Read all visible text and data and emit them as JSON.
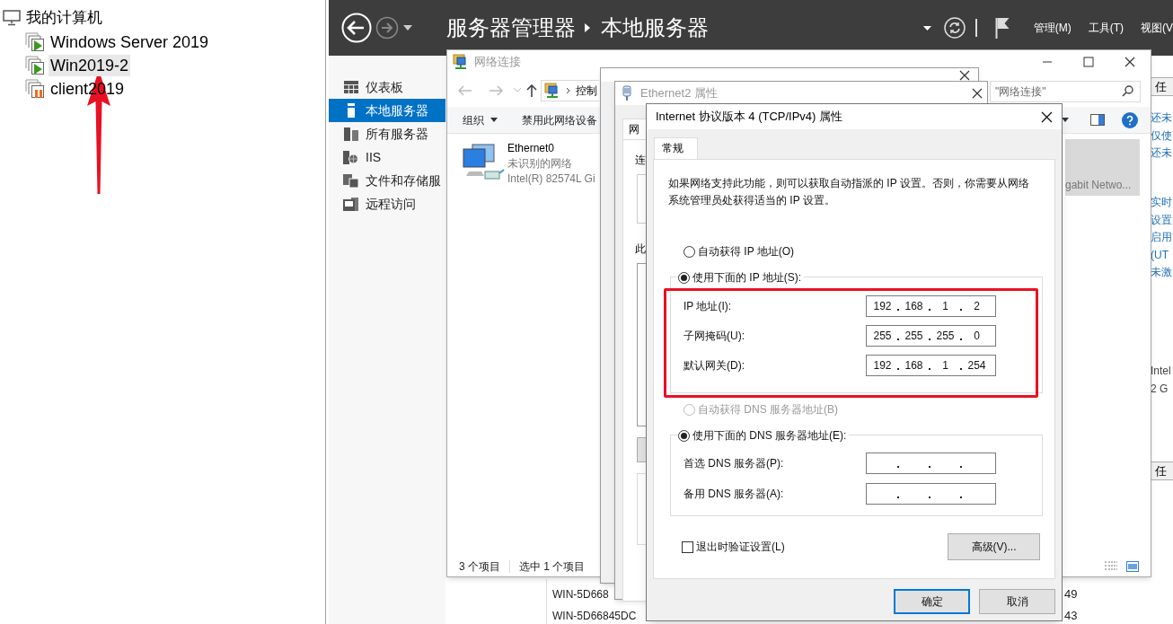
{
  "vm_tree": {
    "label": "我的计算机",
    "children": [
      {
        "label": "Windows Server 2019",
        "kind": "running",
        "selected": false
      },
      {
        "label": "Win2019-2",
        "kind": "running",
        "selected": true
      },
      {
        "label": "client2019",
        "kind": "paused",
        "selected": false
      }
    ]
  },
  "server_manager": {
    "breadcrumb": [
      "服务器管理器",
      "本地服务器"
    ],
    "menus": [
      "管理(M)",
      "工具(T)",
      "视图(V"
    ],
    "nav": [
      {
        "label": "仪表板",
        "kind": "dashboard",
        "selected": false
      },
      {
        "label": "本地服务器",
        "kind": "server",
        "selected": true
      },
      {
        "label": "所有服务器",
        "kind": "servers",
        "selected": false
      },
      {
        "label": "IIS",
        "kind": "iis",
        "selected": false
      },
      {
        "label": "文件和存储服",
        "kind": "files",
        "selected": false
      },
      {
        "label": "远程访问",
        "kind": "remote",
        "selected": false
      }
    ],
    "side_panel": {
      "top_button": "任",
      "links_1": [
        "还未",
        "仅使",
        "还未"
      ],
      "links_2": [
        "实时",
        "设置",
        "启用",
        "(UT",
        "未激"
      ],
      "details": [
        "Intel",
        "2 G"
      ],
      "bottom_button": "任"
    },
    "server_list": [
      {
        "name": "WIN-5D668",
        "column_2": "49"
      },
      {
        "name": "WIN-5D66845DC",
        "column_2": "43"
      }
    ]
  },
  "network_window": {
    "title": "网络连接",
    "address": "控制",
    "search_placeholder": "\"网络连接\"",
    "toolbar": [
      "组织",
      "禁用此网络设备"
    ],
    "items": [
      {
        "name": "Ethernet0",
        "status": "未识别的网络",
        "device": "Intel(R) 82574L Gi",
        "selected": false
      },
      {
        "device": "gabit Netwo...",
        "selected": true
      }
    ],
    "status_bar": [
      "3 个项目",
      "选中 1 个项目"
    ]
  },
  "properties_window": {
    "title": "Ethernet2 属性",
    "tab": "网",
    "labels": [
      "连",
      "此"
    ]
  },
  "ipv4_dialog": {
    "title": "Internet 协议版本 4 (TCP/IPv4) 属性",
    "tab": "常规",
    "description": "如果网络支持此功能，则可以获取自动指派的 IP 设置。否则，你需要从网络系统管理员处获得适当的 IP 设置。",
    "ip_modes": [
      {
        "label": "自动获得 IP 地址(O)",
        "selected": false
      },
      {
        "label": "使用下面的 IP 地址(S):",
        "selected": true
      }
    ],
    "ip_fields": [
      {
        "label": "IP 地址(I):",
        "octets": [
          "192",
          "168",
          "1",
          "2"
        ]
      },
      {
        "label": "子网掩码(U):",
        "octets": [
          "255",
          "255",
          "255",
          "0"
        ]
      },
      {
        "label": "默认网关(D):",
        "octets": [
          "192",
          "168",
          "1",
          "254"
        ]
      }
    ],
    "dns_modes": [
      {
        "label": "自动获得 DNS 服务器地址(B)",
        "selected": false,
        "disabled": true
      },
      {
        "label": "使用下面的 DNS 服务器地址(E):",
        "selected": true,
        "disabled": false
      }
    ],
    "dns_fields": [
      {
        "label": "首选 DNS 服务器(P):"
      },
      {
        "label": "备用 DNS 服务器(A):"
      }
    ],
    "validate": {
      "label": "退出时验证设置(L)",
      "checked": false
    },
    "advanced_button": "高级(V)...",
    "buttons": [
      {
        "label": "确定",
        "default": true
      },
      {
        "label": "取消",
        "default": false
      }
    ]
  },
  "annotations": {
    "highlight_box": true,
    "arrow": true
  }
}
